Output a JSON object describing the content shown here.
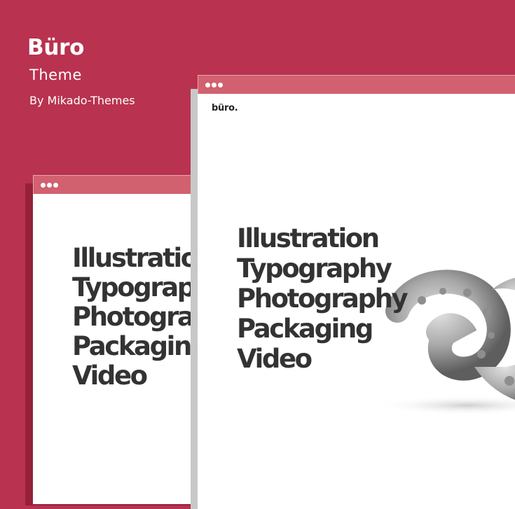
{
  "hero": {
    "title": "Büro",
    "subtitle": "Theme",
    "author": "By Mikado-Themes"
  },
  "back_window": {
    "menu_items": [
      "Illustration",
      "Typography",
      "Photography",
      "Packaging",
      "Video"
    ]
  },
  "front_window": {
    "logo": "büro.",
    "menu_items": [
      "Illustration",
      "Typography",
      "Photography",
      "Packaging",
      "Video"
    ]
  },
  "colors": {
    "background": "#b9324f",
    "browser_bar": "#d1616f",
    "text_dark": "#333333"
  },
  "icons": {
    "window_controls": "three-dots-icon",
    "hero_image": "octopus-tentacle-sculpture-image"
  }
}
